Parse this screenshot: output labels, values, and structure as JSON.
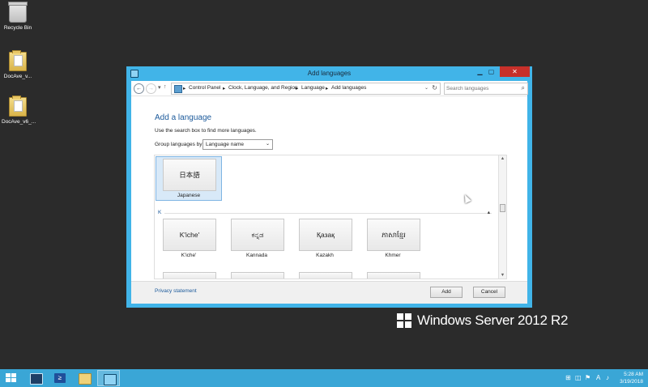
{
  "desktop": {
    "icons": [
      {
        "label": "Recycle Bin",
        "icon": "recycle-bin-icon"
      },
      {
        "label": "DocAve_v...",
        "icon": "folder-icon"
      },
      {
        "label": "DocAve_v6_...",
        "icon": "folder-icon"
      }
    ]
  },
  "window": {
    "title": "Add languages",
    "address": {
      "crumbs": [
        "Control Panel",
        "Clock, Language, and Region",
        "Language",
        "Add languages"
      ]
    },
    "search": {
      "placeholder": "Search languages"
    },
    "heading": "Add a language",
    "hint": "Use the search box to find more languages.",
    "group_by": {
      "label": "Group languages by:",
      "value": "Language name"
    },
    "languages": {
      "selected": {
        "native": "日本語",
        "name": "Japanese"
      },
      "group_k": {
        "header": "K",
        "items": [
          {
            "native": "K'iche'",
            "name": "K'iche'"
          },
          {
            "native": "ಕನ್ನಡ",
            "name": "Kannada"
          },
          {
            "native": "Қазақ",
            "name": "Kazakh"
          },
          {
            "native": "ភាសាខ្មែរ",
            "name": "Khmer"
          }
        ]
      }
    },
    "footer": {
      "privacy": "Privacy statement",
      "add": "Add",
      "cancel": "Cancel"
    }
  },
  "branding": {
    "text": "Windows Server 2012 R2"
  },
  "taskbar": {
    "clock": {
      "time": "5:28 AM",
      "date": "3/19/2018"
    }
  },
  "colors": {
    "window_frame": "#41b4e8",
    "taskbar": "#3aa6d6",
    "desktop": "#2b2b2b",
    "close": "#c7302a",
    "link": "#1c5a9b"
  }
}
